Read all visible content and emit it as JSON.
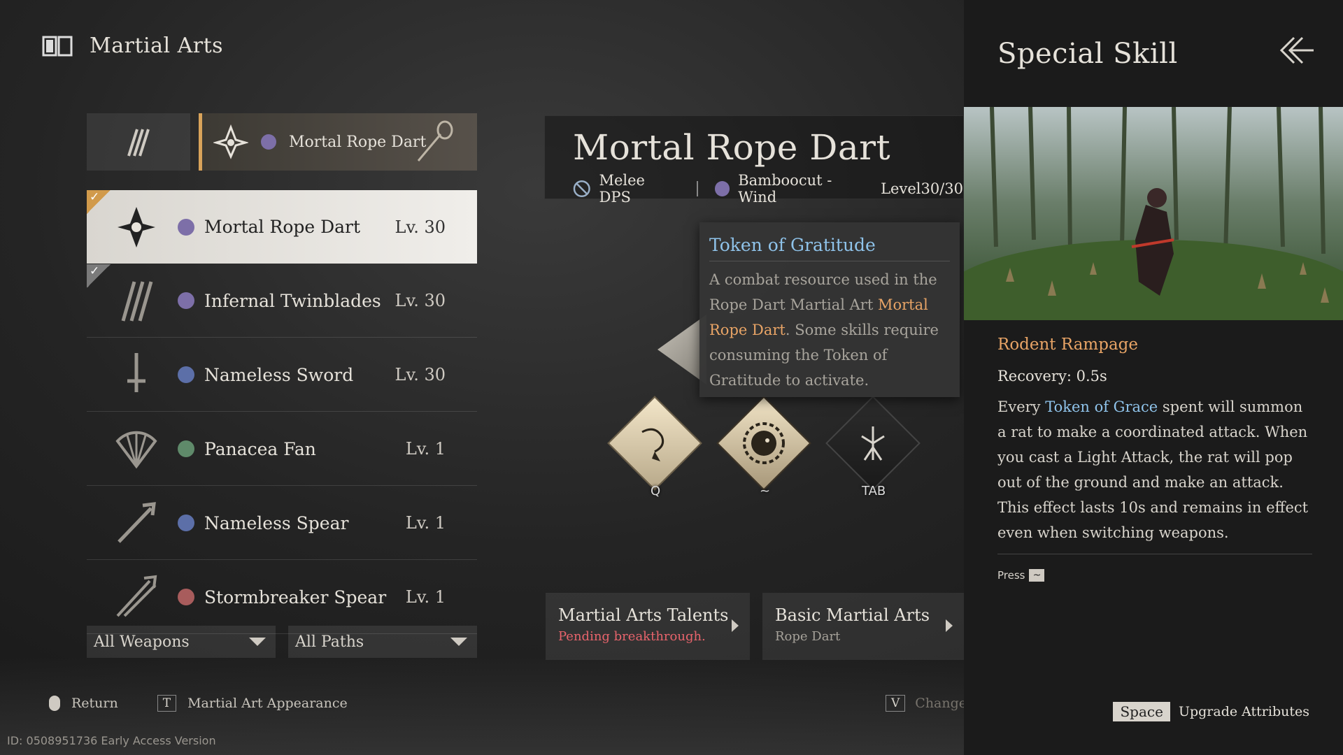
{
  "header": {
    "title": "Martial Arts",
    "icon": "book-icon"
  },
  "tabs": {
    "active_label": "Mortal Rope Dart"
  },
  "weapons": [
    {
      "name": "Mortal Rope Dart",
      "level": "Lv. 30",
      "path_icon": "path-bamboocut-icon",
      "path_color": "#7d6fa8"
    },
    {
      "name": "Infernal Twinblades",
      "level": "Lv. 30",
      "path_icon": "path-bamboocut-icon",
      "path_color": "#7d6fa8"
    },
    {
      "name": "Nameless Sword",
      "level": "Lv. 30",
      "path_icon": "path-bellstrike-icon",
      "path_color": "#5c6fa8"
    },
    {
      "name": "Panacea Fan",
      "level": "Lv. 1",
      "path_icon": "path-silkbind-icon",
      "path_color": "#5f8a6a"
    },
    {
      "name": "Nameless Spear",
      "level": "Lv. 1",
      "path_icon": "path-bellstrike-icon",
      "path_color": "#5c6fa8"
    },
    {
      "name": "Stormbreaker Spear",
      "level": "Lv. 1",
      "path_icon": "path-stonesplit-icon",
      "path_color": "#a85c5c"
    }
  ],
  "filters": {
    "weapons": "All Weapons",
    "paths": "All Paths"
  },
  "detail": {
    "title": "Mortal Rope Dart",
    "role": "Melee DPS",
    "path": "Bamboocut - Wind",
    "level": "Level30/30"
  },
  "tooltip": {
    "title": "Token of Gratitude",
    "body_1": "A combat resource used in the Rope Dart Martial Art ",
    "highlight": "Mortal Rope Dart",
    "body_2": ". Some skills require consuming the Token of Gratitude to activate."
  },
  "skills": [
    {
      "key": "Q",
      "icon": "rope-dart-skill-icon"
    },
    {
      "key": "~",
      "icon": "rat-skill-icon"
    },
    {
      "key": "TAB",
      "icon": "figure-skill-icon"
    }
  ],
  "panels": {
    "talents_title": "Martial Arts Talents",
    "talents_sub": "Pending breakthrough.",
    "basic_title": "Basic Martial Arts",
    "basic_sub": "Rope Dart"
  },
  "hints": {
    "return": "Return",
    "appearance_key": "T",
    "appearance": "Martial Art Appearance",
    "change_key": "V",
    "change": "Change Gear"
  },
  "id_line": "ID: 0508951736 Early Access Version",
  "right": {
    "title": "Special Skill",
    "skill_name": "Rodent Rampage",
    "recovery": "Recovery: 0.5s",
    "desc_1": "Every ",
    "desc_hl": "Token of Grace",
    "desc_2": " spent will summon a rat to make a coordinated attack. When you cast a Light Attack, the rat will pop out of the ground and make an attack. This effect lasts 10s and remains in effect even when switching weapons.",
    "press": "Press",
    "press_key": "~",
    "upgrade_key": "Space",
    "upgrade": "Upgrade Attributes"
  },
  "colors": {
    "accent": "#d9a35a",
    "highlight_orange": "#e8a466",
    "highlight_blue": "#8fc3ea",
    "warning_red": "#e8646c"
  }
}
